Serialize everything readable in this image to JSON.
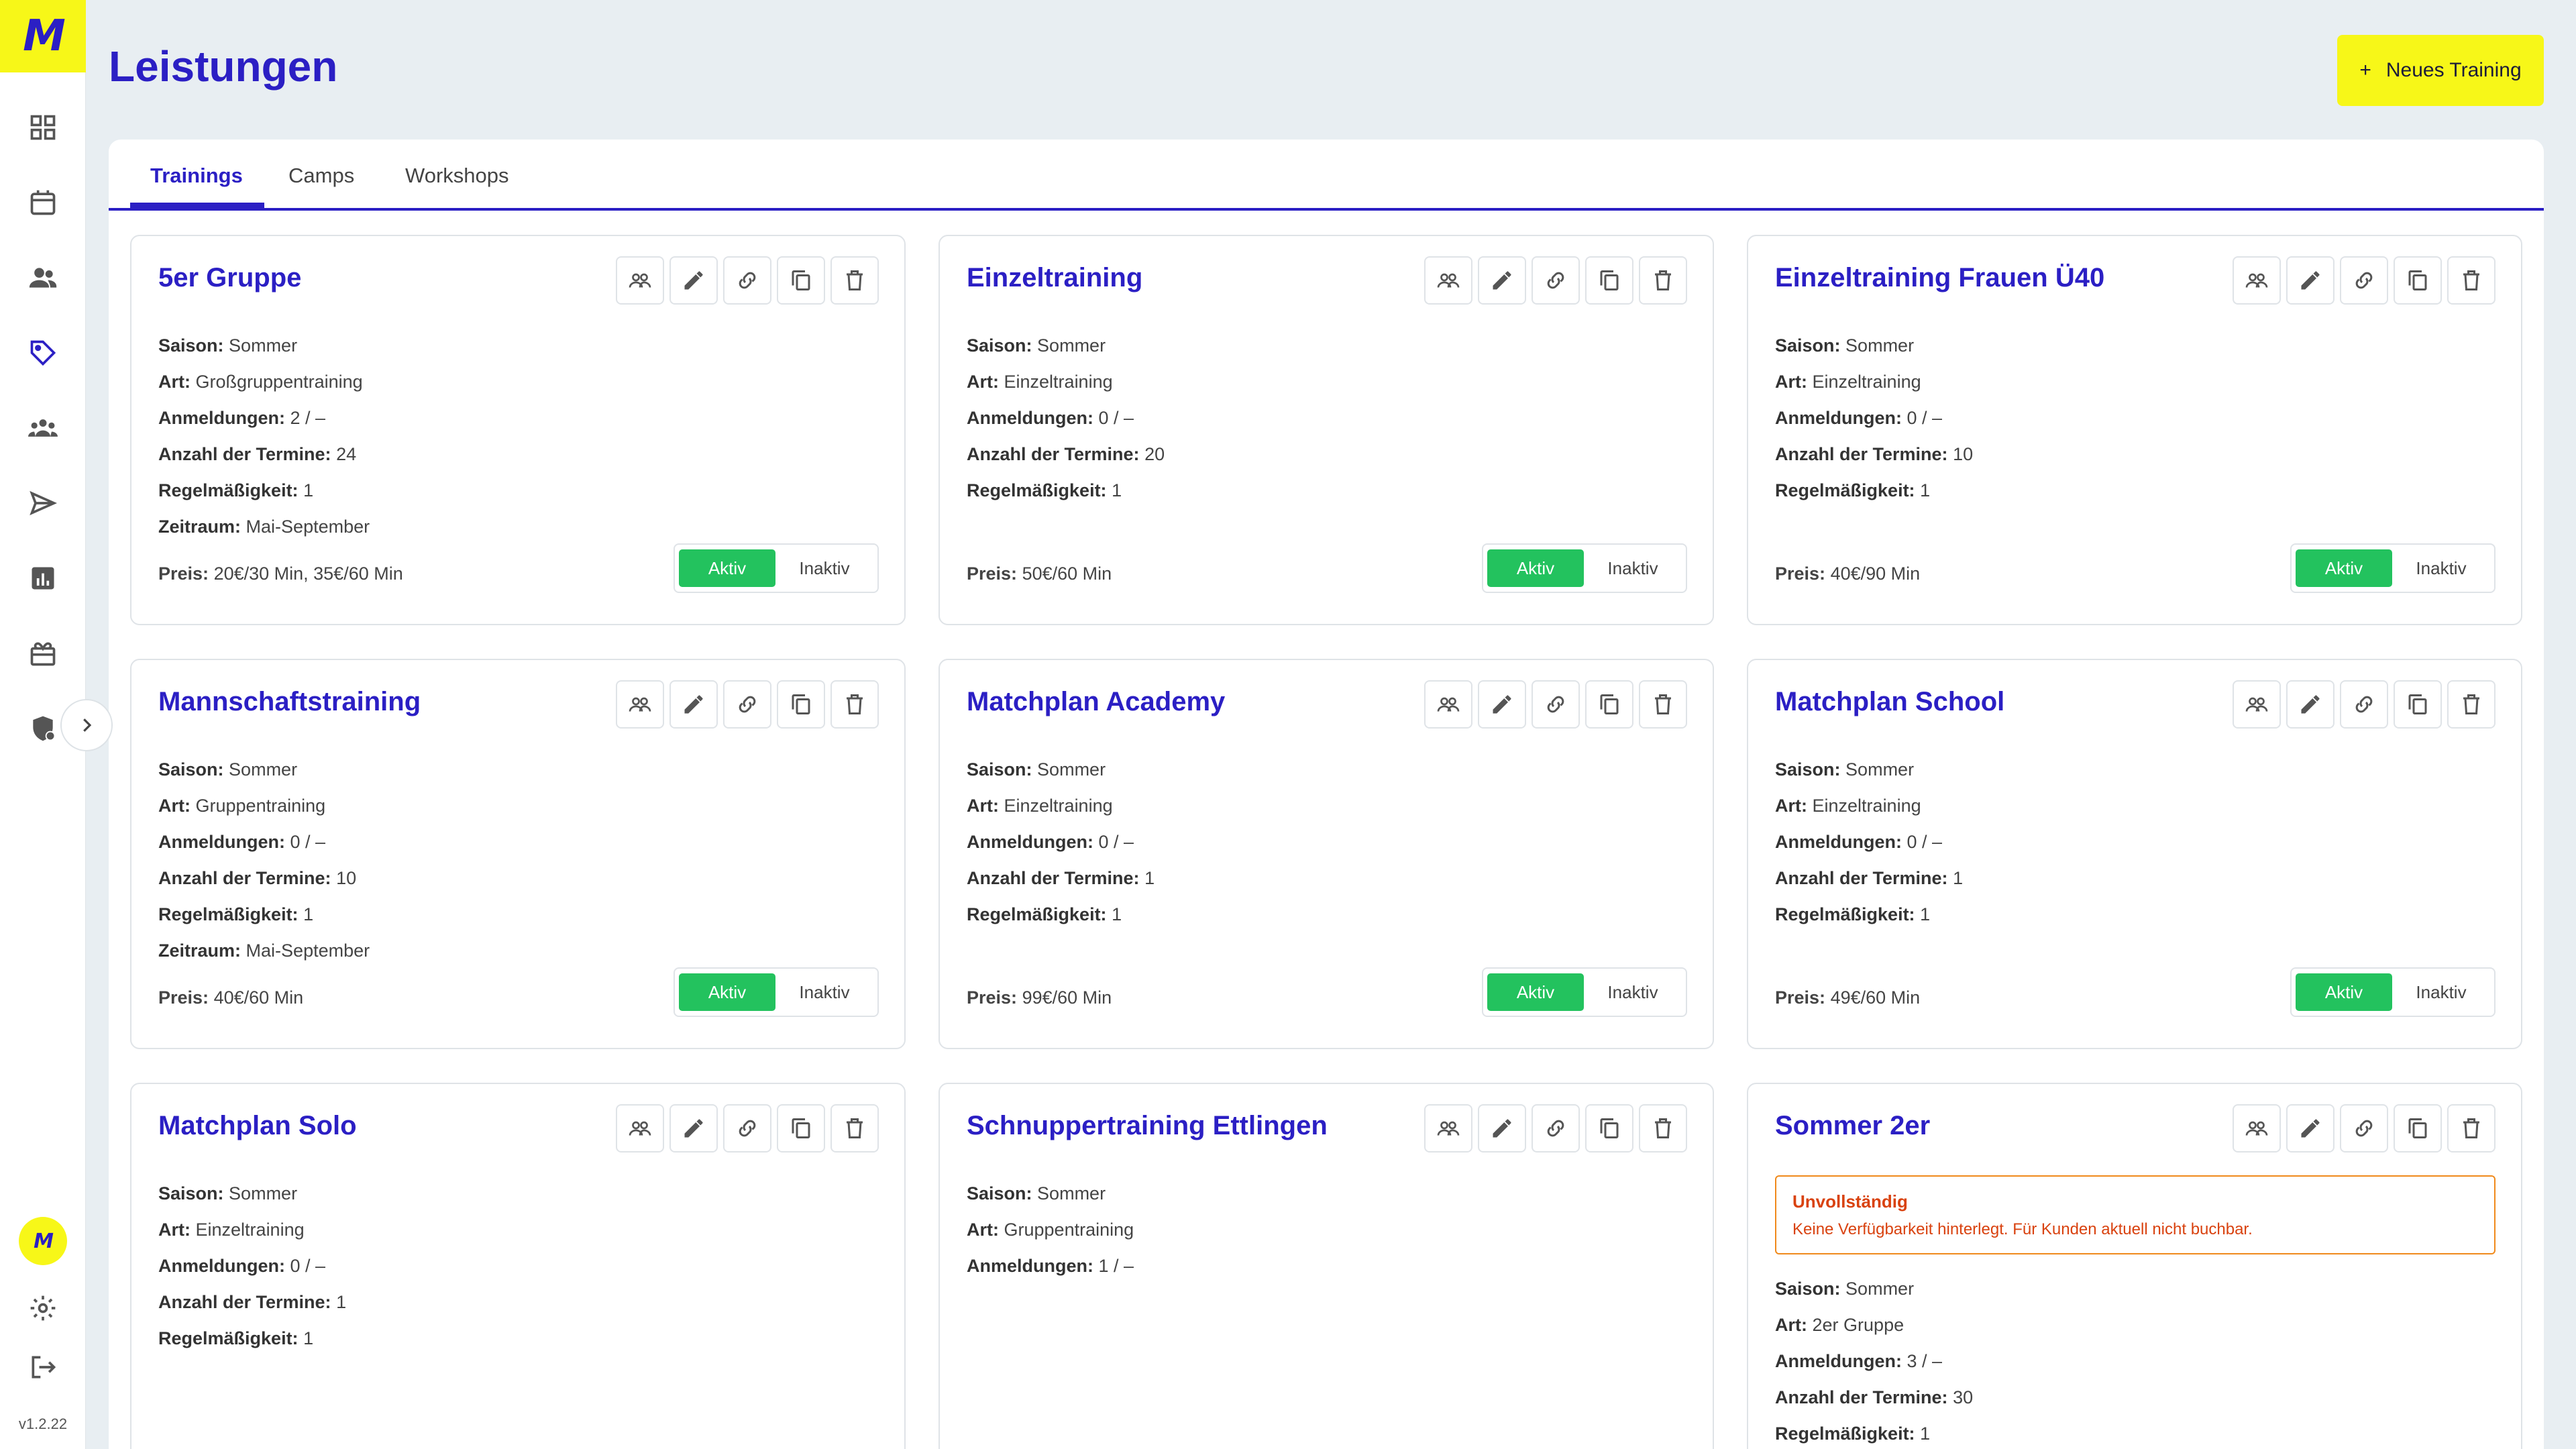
{
  "app": {
    "logo_text": "M",
    "version": "v1.2.22",
    "accent": "#2b1fc4",
    "brand_yellow": "#f7f718",
    "active_green": "#23c25e"
  },
  "sidebar": {
    "items": [
      {
        "icon": "dashboard-icon"
      },
      {
        "icon": "calendar-icon"
      },
      {
        "icon": "people-icon"
      },
      {
        "icon": "tag-icon"
      },
      {
        "icon": "groups-icon"
      },
      {
        "icon": "send-icon"
      },
      {
        "icon": "bar-chart-icon"
      },
      {
        "icon": "gift-icon"
      },
      {
        "icon": "shield-icon"
      }
    ],
    "bottom": [
      {
        "icon": "avatar"
      },
      {
        "icon": "gear-icon"
      },
      {
        "icon": "logout-icon"
      }
    ]
  },
  "header": {
    "title": "Leistungen",
    "new_button_icon": "+",
    "new_button_label": "Neues Training"
  },
  "tabs": [
    {
      "label": "Trainings",
      "active": true
    },
    {
      "label": "Camps",
      "active": false
    },
    {
      "label": "Workshops",
      "active": false
    }
  ],
  "labels": {
    "saison": "Saison:",
    "art": "Art:",
    "anmeldungen": "Anmeldungen:",
    "termine": "Anzahl der Termine:",
    "regel": "Regelmäßigkeit:",
    "zeitraum": "Zeitraum:",
    "preis": "Preis:",
    "aktiv": "Aktiv",
    "inaktiv": "Inaktiv"
  },
  "cards": [
    {
      "title": "5er Gruppe",
      "saison": "Sommer",
      "art": "Großgruppentraining",
      "anmeldungen": "2 / –",
      "termine": "24",
      "regel": "1",
      "zeitraum": "Mai-September",
      "preis": "20€/30 Min, 35€/60 Min",
      "status": "Aktiv"
    },
    {
      "title": "Einzeltraining",
      "saison": "Sommer",
      "art": "Einzeltraining",
      "anmeldungen": "0 / –",
      "termine": "20",
      "regel": "1",
      "preis": "50€/60 Min",
      "status": "Aktiv"
    },
    {
      "title": "Einzeltraining Frauen Ü40",
      "saison": "Sommer",
      "art": "Einzeltraining",
      "anmeldungen": "0 / –",
      "termine": "10",
      "regel": "1",
      "preis": "40€/90 Min",
      "status": "Aktiv"
    },
    {
      "title": "Mannschaftstraining",
      "saison": "Sommer",
      "art": "Gruppentraining",
      "anmeldungen": "0 / –",
      "termine": "10",
      "regel": "1",
      "zeitraum": "Mai-September",
      "preis": "40€/60 Min",
      "status": "Aktiv"
    },
    {
      "title": "Matchplan Academy",
      "saison": "Sommer",
      "art": "Einzeltraining",
      "anmeldungen": "0 / –",
      "termine": "1",
      "regel": "1",
      "preis": "99€/60 Min",
      "status": "Aktiv"
    },
    {
      "title": "Matchplan School",
      "saison": "Sommer",
      "art": "Einzeltraining",
      "anmeldungen": "0 / –",
      "termine": "1",
      "regel": "1",
      "preis": "49€/60 Min",
      "status": "Aktiv"
    },
    {
      "title": "Matchplan Solo",
      "saison": "Sommer",
      "art": "Einzeltraining",
      "anmeldungen": "0 / –",
      "termine": "1",
      "regel": "1"
    },
    {
      "title": "Schnuppertraining Ettlingen",
      "saison": "Sommer",
      "art": "Gruppentraining",
      "anmeldungen": "1 / –"
    },
    {
      "title": "Sommer 2er",
      "warning_title": "Unvollständig",
      "warning_text": "Keine Verfügbarkeit hinterlegt. Für Kunden aktuell nicht buchbar.",
      "saison": "Sommer",
      "art": "2er Gruppe",
      "anmeldungen": "3 / –",
      "termine": "30",
      "regel": "1"
    }
  ]
}
